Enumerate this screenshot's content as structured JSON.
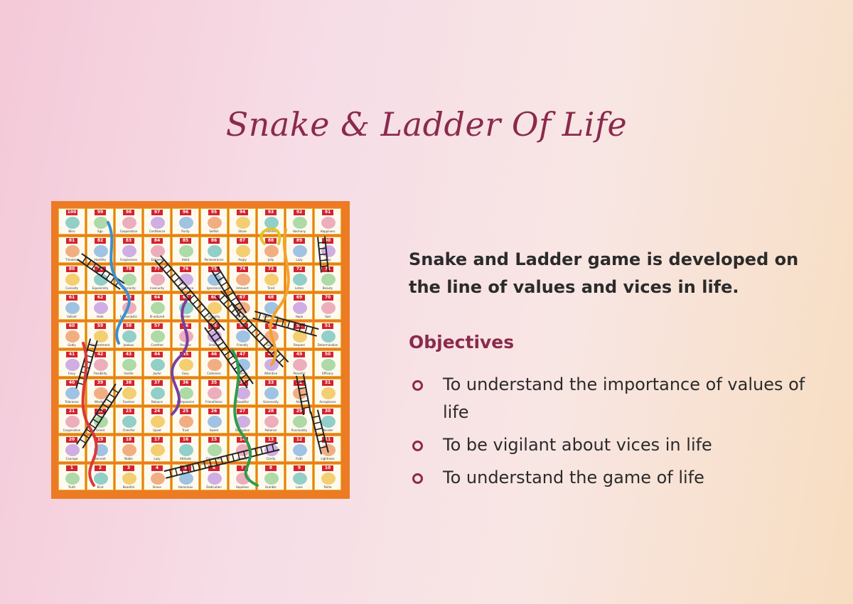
{
  "title": "Snake & Ladder Of Life",
  "intro": "Snake and Ladder game is developed on the line of values and vices in life.",
  "objectives_heading": "Objectives",
  "objectives": [
    "To understand the importance of values of life",
    "To be vigilant  about vices in life",
    "To understand the game of life"
  ],
  "colors": {
    "accent": "#8a2a4c",
    "board_border": "#ec7b23",
    "cell_number": "#d3232f"
  },
  "board": {
    "grid_size": 10,
    "rows": [
      [
        {
          "n": 100,
          "label": "Bliss"
        },
        {
          "n": 99,
          "label": "Ego"
        },
        {
          "n": 98,
          "label": "Cooperation"
        },
        {
          "n": 97,
          "label": "Confidence"
        },
        {
          "n": 96,
          "label": "Purity"
        },
        {
          "n": 95,
          "label": "Selfish"
        },
        {
          "n": 94,
          "label": "Share"
        },
        {
          "n": 93,
          "label": "Shame"
        },
        {
          "n": 92,
          "label": "Harmony"
        },
        {
          "n": 91,
          "label": "Happiness"
        }
      ],
      [
        {
          "n": 81,
          "label": "Timeless"
        },
        {
          "n": 82,
          "label": "Hostility"
        },
        {
          "n": 83,
          "label": "Forgiveness"
        },
        {
          "n": 84,
          "label": "Extreme"
        },
        {
          "n": 85,
          "label": "Habit"
        },
        {
          "n": 86,
          "label": "Perseverance"
        },
        {
          "n": 87,
          "label": "Angry"
        },
        {
          "n": 88,
          "label": "Jolly"
        },
        {
          "n": 89,
          "label": "Lazy"
        },
        {
          "n": 90,
          "label": "Holy"
        }
      ],
      [
        {
          "n": 80,
          "label": "Curiosity"
        },
        {
          "n": 79,
          "label": "Equanimity"
        },
        {
          "n": 78,
          "label": "Inferiority"
        },
        {
          "n": 77,
          "label": "Insecurity"
        },
        {
          "n": 76,
          "label": "Impatience"
        },
        {
          "n": 75,
          "label": "Ignorance"
        },
        {
          "n": 74,
          "label": "Introvert"
        },
        {
          "n": 73,
          "label": "Tired"
        },
        {
          "n": 72,
          "label": "Listen"
        },
        {
          "n": 71,
          "label": "Beauty"
        }
      ],
      [
        {
          "n": 61,
          "label": "Valiant"
        },
        {
          "n": 62,
          "label": "Hate"
        },
        {
          "n": 63,
          "label": "Enthusiastic"
        },
        {
          "n": 64,
          "label": "Ill-natured"
        },
        {
          "n": 65,
          "label": "Builder"
        },
        {
          "n": 66,
          "label": "Integrity"
        },
        {
          "n": 67,
          "label": "Strong"
        },
        {
          "n": 68,
          "label": "Obedience"
        },
        {
          "n": 69,
          "label": "Hope"
        },
        {
          "n": 70,
          "label": "Sad"
        }
      ],
      [
        {
          "n": 60,
          "label": "Godly"
        },
        {
          "n": 59,
          "label": "Contentment"
        },
        {
          "n": 58,
          "label": "Jealous"
        },
        {
          "n": 57,
          "label": "Carefree"
        },
        {
          "n": 56,
          "label": "Positive"
        },
        {
          "n": 55,
          "label": "Smiling"
        },
        {
          "n": 54,
          "label": "Friendly"
        },
        {
          "n": 53,
          "label": "Godly"
        },
        {
          "n": 52,
          "label": "Respect"
        },
        {
          "n": 51,
          "label": "Determination"
        }
      ],
      [
        {
          "n": 41,
          "label": "Envy"
        },
        {
          "n": 42,
          "label": "Flexibility"
        },
        {
          "n": 43,
          "label": "Gentle"
        },
        {
          "n": 44,
          "label": "Joyful"
        },
        {
          "n": 45,
          "label": "Easy"
        },
        {
          "n": 46,
          "label": "Calmness"
        },
        {
          "n": 47,
          "label": "Serene"
        },
        {
          "n": 48,
          "label": "Attentive"
        },
        {
          "n": 49,
          "label": "Peaceful"
        },
        {
          "n": 50,
          "label": "Efficacy"
        }
      ],
      [
        {
          "n": 40,
          "label": "Tolerance"
        },
        {
          "n": 39,
          "label": "Wisdom"
        },
        {
          "n": 38,
          "label": "Fearless"
        },
        {
          "n": 37,
          "label": "Balance"
        },
        {
          "n": 36,
          "label": "Compassion"
        },
        {
          "n": 35,
          "label": "Friendliness"
        },
        {
          "n": 34,
          "label": "Doubtful"
        },
        {
          "n": 33,
          "label": "Generosity"
        },
        {
          "n": 32,
          "label": "Alert"
        },
        {
          "n": 31,
          "label": "Acceptance"
        }
      ],
      [
        {
          "n": 21,
          "label": "Cooperation"
        },
        {
          "n": 22,
          "label": "Greed"
        },
        {
          "n": 23,
          "label": "Cheerful"
        },
        {
          "n": 24,
          "label": "Upset"
        },
        {
          "n": 25,
          "label": "Trust"
        },
        {
          "n": 26,
          "label": "Sweet"
        },
        {
          "n": 27,
          "label": "Deception"
        },
        {
          "n": 28,
          "label": "Patience"
        },
        {
          "n": 29,
          "label": "Punctuality"
        },
        {
          "n": 30,
          "label": "Wonder"
        }
      ],
      [
        {
          "n": 20,
          "label": "Courage"
        },
        {
          "n": 19,
          "label": "Servant"
        },
        {
          "n": 18,
          "label": "Noble"
        },
        {
          "n": 17,
          "label": "Lazy"
        },
        {
          "n": 16,
          "label": "Attitude"
        },
        {
          "n": 15,
          "label": "Cleanliness"
        },
        {
          "n": 14,
          "label": "Victory"
        },
        {
          "n": 13,
          "label": "Clarity"
        },
        {
          "n": 12,
          "label": "Faith"
        },
        {
          "n": 11,
          "label": "Lightness"
        }
      ],
      [
        {
          "n": 1,
          "label": "Truth"
        },
        {
          "n": 2,
          "label": "Kind"
        },
        {
          "n": 3,
          "label": "Boastful"
        },
        {
          "n": 4,
          "label": "Brave"
        },
        {
          "n": 5,
          "label": "Humorous"
        },
        {
          "n": 6,
          "label": "Dedication"
        },
        {
          "n": 7,
          "label": "Hopeless"
        },
        {
          "n": 8,
          "label": "Humble"
        },
        {
          "n": 9,
          "label": "Love"
        },
        {
          "n": 10,
          "label": "Polite"
        }
      ]
    ]
  }
}
